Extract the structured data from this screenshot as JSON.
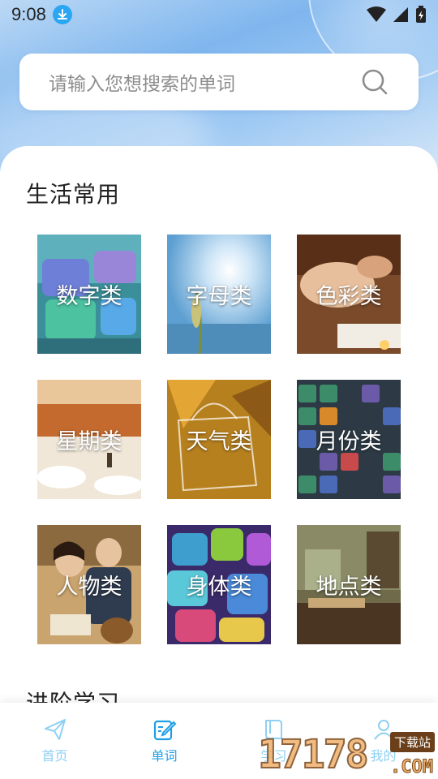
{
  "status_bar": {
    "time": "9:08"
  },
  "search": {
    "placeholder": "请输入您想搜索的单词"
  },
  "sections": {
    "daily": "生活常用",
    "advanced": "进阶学习"
  },
  "categories": [
    {
      "label": "数字类",
      "image": "abc-blocks"
    },
    {
      "label": "字母类",
      "image": "sky-grass"
    },
    {
      "label": "色彩类",
      "image": "spa-massage"
    },
    {
      "label": "星期类",
      "image": "autumn-field"
    },
    {
      "label": "天气类",
      "image": "autumn-bag"
    },
    {
      "label": "月份类",
      "image": "number-tiles"
    },
    {
      "label": "人物类",
      "image": "family-reading"
    },
    {
      "label": "身体类",
      "image": "letter-keys"
    },
    {
      "label": "地点类",
      "image": "library-desk"
    }
  ],
  "nav": [
    {
      "label": "首页",
      "icon": "send-icon",
      "active": false
    },
    {
      "label": "单词",
      "icon": "edit-icon",
      "active": true
    },
    {
      "label": "学习",
      "icon": "book-icon",
      "active": false
    },
    {
      "label": "我的",
      "icon": "user-icon",
      "active": false
    }
  ],
  "watermark": {
    "digits": "17178",
    "badge": "下载站",
    "suffix": ".COM"
  },
  "colors": {
    "accent": "#1f9fe6",
    "inactive_nav": "#8fd0f3"
  }
}
